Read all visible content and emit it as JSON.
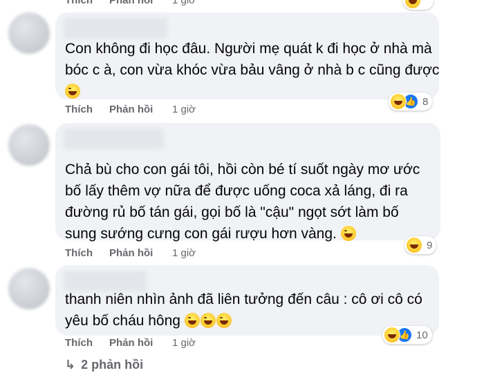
{
  "top_actions": {
    "like": "Thích",
    "reply": "Phản hồi",
    "time": "1 giờ"
  },
  "comments": [
    {
      "lines": [
        "Con không đi học đâu. Người mẹ quát k đi học ở nhà mà",
        "bóc c à, con vừa khóc vừa bảu vâng ở nhà b c cũng được",
        ""
      ],
      "like": "Thích",
      "reply": "Phản hồi",
      "time": "1 giờ",
      "reaction_count": "8"
    },
    {
      "lines": [
        "Chả bù cho con gái tôi, hồi còn bé tí suốt ngày mơ ước",
        "bố lấy thêm vợ nữa để được uống coca xả láng, đi ra",
        "đường rủ bố tán gái, gọi bố là \"cậu\" ngọt sớt làm bố",
        "sung sướng cưng con gái rượu hơn vàng."
      ],
      "like": "Thích",
      "reply": "Phản hồi",
      "time": "1 giờ",
      "reaction_count": "9"
    },
    {
      "lines": [
        "thanh niên nhìn ảnh đã liên tưởng đến câu : cô ơi cô có",
        "yêu bố cháu hông"
      ],
      "like": "Thích",
      "reply": "Phản hồi",
      "time": "1 giờ",
      "reaction_count": "10"
    }
  ],
  "replies_link": "2 phản hồi",
  "icons": {
    "haha": "haha-reaction-icon",
    "like": "like-reaction-icon",
    "reply_arrow": "reply-arrow-icon"
  }
}
